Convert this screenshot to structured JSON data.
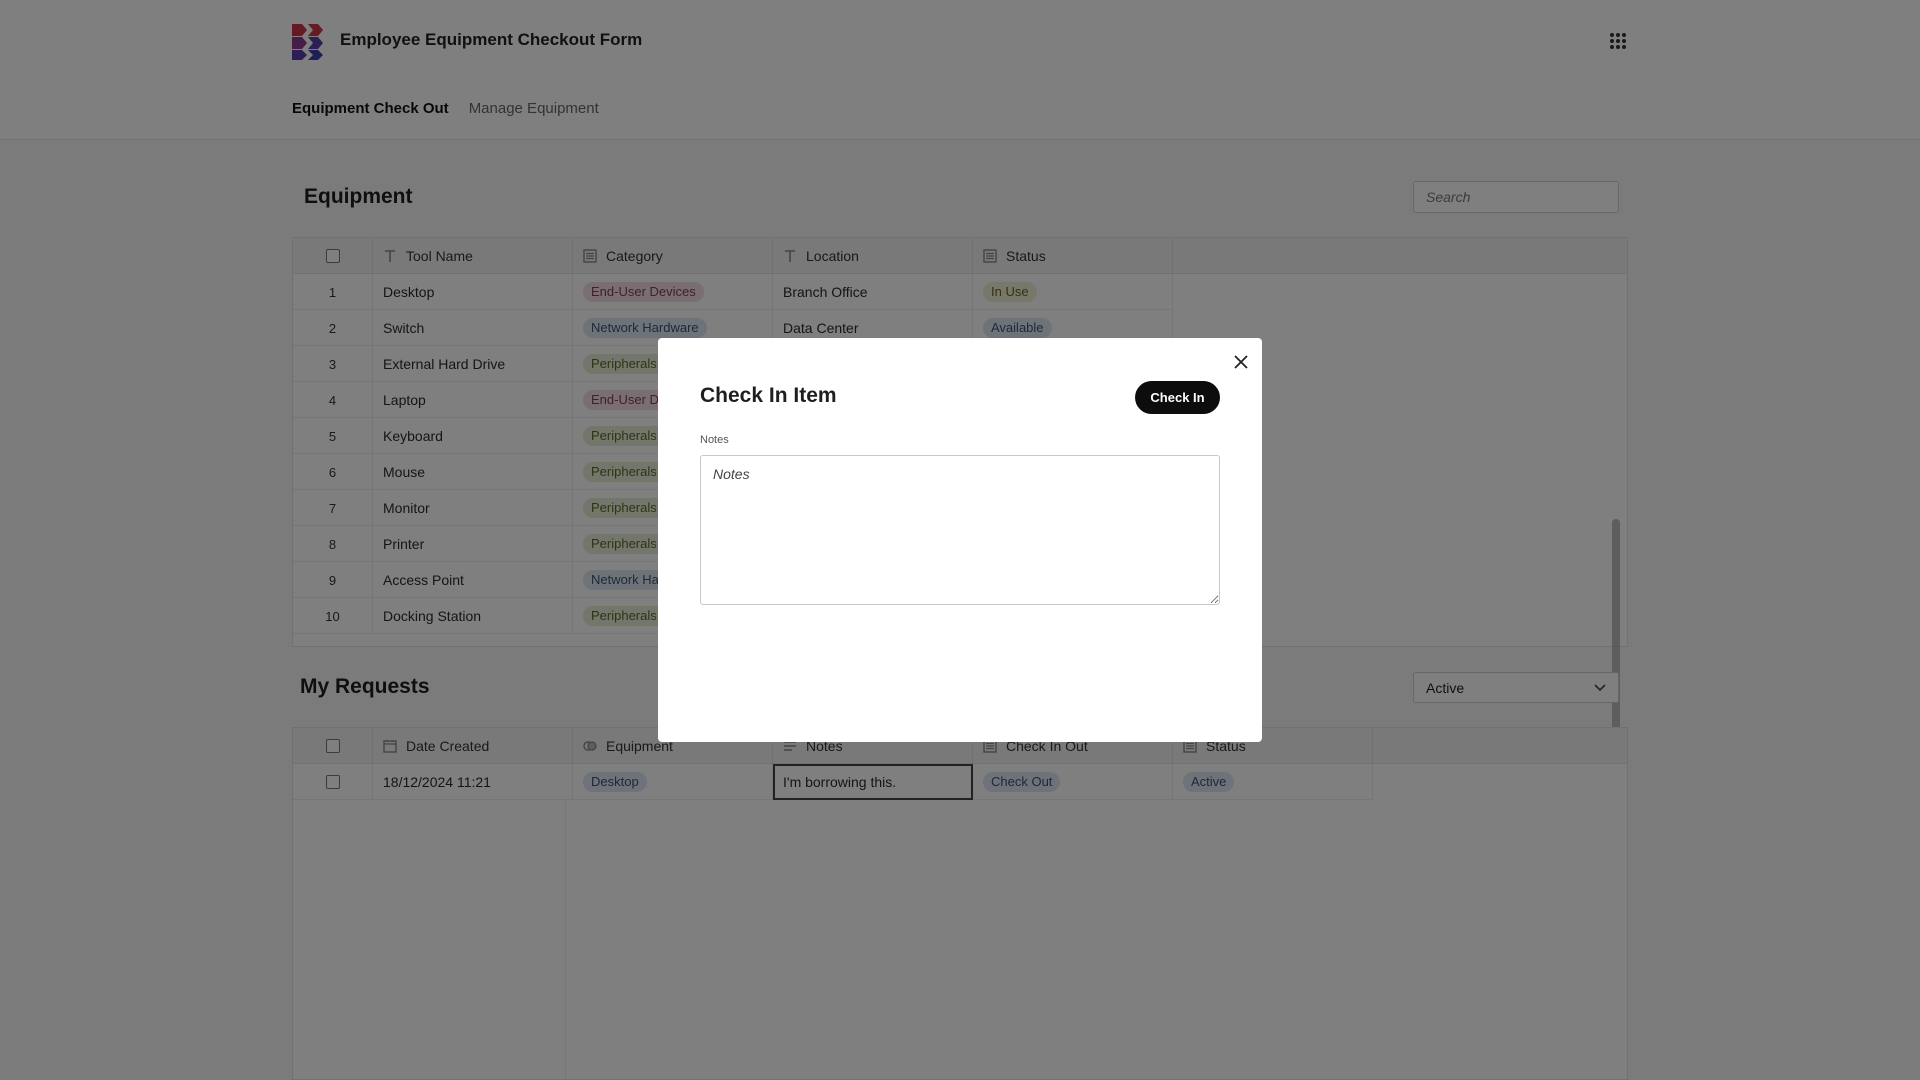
{
  "app": {
    "title": "Employee Equipment Checkout Form",
    "brand_colors": [
      "#c9374a",
      "#5a3fa8"
    ]
  },
  "nav": {
    "tabs": [
      {
        "label": "Equipment Check Out",
        "active": true
      },
      {
        "label": "Manage Equipment",
        "active": false
      }
    ]
  },
  "equipment": {
    "title": "Equipment",
    "search_placeholder": "Search",
    "columns": [
      "Tool Name",
      "Category",
      "Location",
      "Status"
    ],
    "rows": [
      {
        "idx": "1",
        "name": "Desktop",
        "category": "End-User Devices",
        "location": "Branch Office",
        "status": "In Use"
      },
      {
        "idx": "2",
        "name": "Switch",
        "category": "Network Hardware",
        "location": "Data Center",
        "status": "Available"
      },
      {
        "idx": "3",
        "name": "External Hard Drive",
        "category": "Peripherals",
        "location": "",
        "status": ""
      },
      {
        "idx": "4",
        "name": "Laptop",
        "category": "End-User Dev",
        "location": "",
        "status": ""
      },
      {
        "idx": "5",
        "name": "Keyboard",
        "category": "Peripherals",
        "location": "",
        "status": ""
      },
      {
        "idx": "6",
        "name": "Mouse",
        "category": "Peripherals",
        "location": "",
        "status": ""
      },
      {
        "idx": "7",
        "name": "Monitor",
        "category": "Peripherals",
        "location": "",
        "status": ""
      },
      {
        "idx": "8",
        "name": "Printer",
        "category": "Peripherals",
        "location": "",
        "status": ""
      },
      {
        "idx": "9",
        "name": "Access Point",
        "category": "Network Harc",
        "location": "",
        "status": ""
      },
      {
        "idx": "10",
        "name": "Docking Station",
        "category": "Peripherals",
        "location": "",
        "status": ""
      }
    ]
  },
  "requests": {
    "title": "My Requests",
    "filter_value": "Active",
    "columns": [
      "Date Created",
      "Equipment",
      "Notes",
      "Check In Out",
      "Status"
    ],
    "rows": [
      {
        "date": "18/12/2024 11:21",
        "equipment": "Desktop",
        "notes": "I'm borrowing this.",
        "check": "Check Out",
        "status": "Active"
      }
    ]
  },
  "modal": {
    "title": "Check In Item",
    "button": "Check In",
    "notes_label": "Notes",
    "notes_placeholder": "Notes"
  }
}
